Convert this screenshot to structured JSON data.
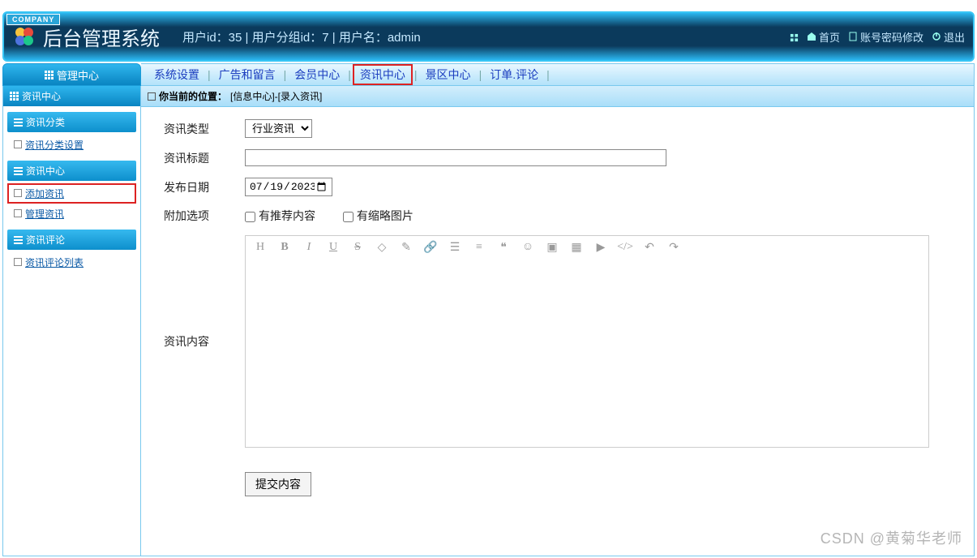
{
  "company_tag": "COMPANY",
  "header": {
    "title": "后台管理系统",
    "userinfo": "用户id：35 | 用户分组id：7 | 用户名：admin",
    "links": {
      "home": "首页",
      "pwd": "账号密码修改",
      "logout": "退出"
    }
  },
  "topbar": {
    "left": "管理中心",
    "items": [
      "系统设置",
      "广告和留言",
      "会员中心",
      "资讯中心",
      "景区中心",
      "订单.评论"
    ],
    "active_index": 3
  },
  "sidebar": {
    "head": "资讯中心",
    "sections": [
      {
        "title": "资讯分类",
        "items": [
          {
            "label": "资讯分类设置",
            "hl": false
          }
        ]
      },
      {
        "title": "资讯中心",
        "items": [
          {
            "label": "添加资讯",
            "hl": true
          },
          {
            "label": "管理资讯",
            "hl": false
          }
        ]
      },
      {
        "title": "资讯评论",
        "items": [
          {
            "label": "资讯评论列表",
            "hl": false
          }
        ]
      }
    ]
  },
  "breadcrumb": {
    "prefix": "你当前的位置：",
    "path": "[信息中心]-[录入资讯]"
  },
  "form": {
    "type_label": "资讯类型",
    "type_value": "行业资讯",
    "title_label": "资讯标题",
    "title_value": "",
    "date_label": "发布日期",
    "date_value": "2023/07/19",
    "extra_label": "附加选项",
    "cb1": "有推荐内容",
    "cb2": "有缩略图片",
    "content_label": "资讯内容",
    "submit": "提交内容"
  },
  "watermark": "CSDN @黄菊华老师"
}
